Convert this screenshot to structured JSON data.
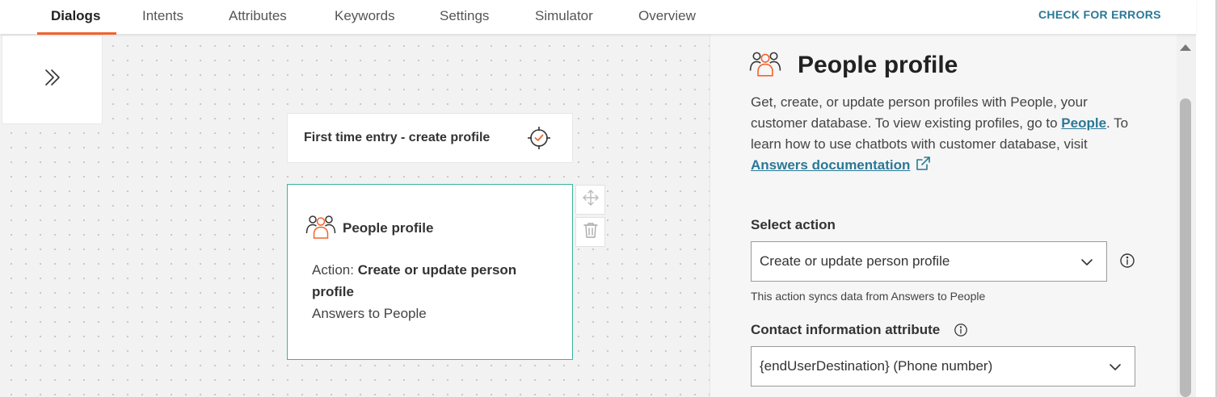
{
  "tabs": [
    {
      "label": "Dialogs",
      "active": true
    },
    {
      "label": "Intents"
    },
    {
      "label": "Attributes"
    },
    {
      "label": "Keywords"
    },
    {
      "label": "Settings"
    },
    {
      "label": "Simulator"
    },
    {
      "label": "Overview"
    }
  ],
  "header": {
    "check_errors_label": "CHECK FOR ERRORS"
  },
  "colors": {
    "accent": "#f2632d",
    "link": "#2a7896",
    "node_border_active": "#3ab49c"
  },
  "canvas": {
    "expand_icon": "double-chevron-right-icon",
    "entry_node": {
      "title": "First time entry - create profile",
      "icon": "target-check-icon"
    },
    "people_node": {
      "title": "People profile",
      "icon": "people-icon",
      "action_prefix": "Action: ",
      "action_value": "Create or update person profile",
      "subtitle": "Answers to People"
    },
    "tools": [
      "move-icon",
      "trash-icon"
    ]
  },
  "panel": {
    "title": "People profile",
    "description_1": "Get, create, or update person profiles with People, your customer database. To view existing profiles, go to ",
    "people_link": "People",
    "description_2": ". To learn how to use chatbots with customer database, visit ",
    "docs_link": "Answers documentation",
    "select_action_label": "Select action",
    "select_action_value": "Create or update person profile",
    "select_action_hint": "This action syncs data from Answers to People",
    "contact_label": "Contact information attribute",
    "contact_value": "{endUserDestination} (Phone number)"
  }
}
